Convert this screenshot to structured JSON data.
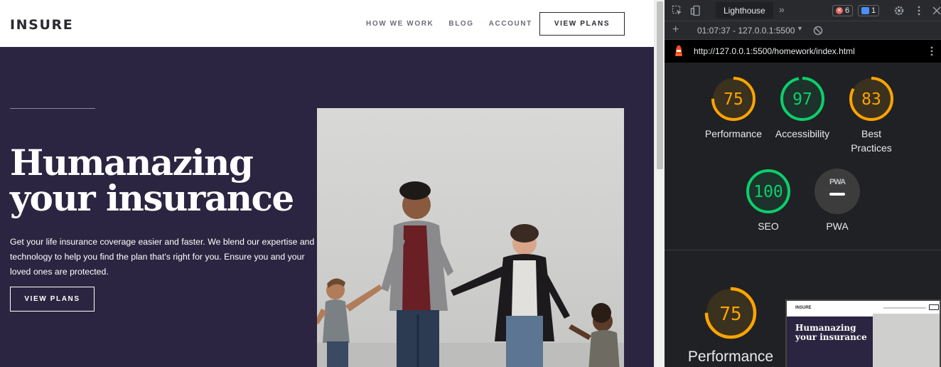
{
  "site": {
    "logo": "INSURE",
    "nav": [
      "HOW WE WORK",
      "BLOG",
      "ACCOUNT"
    ],
    "nav_button": "VIEW PLANS",
    "hero_title_line1": "Humanazing",
    "hero_title_line2": "your insurance",
    "hero_text": "Get your life insurance coverage easier and faster. We blend our expertise and technology to help you find the plan that's right for you. Ensure you and your loved ones are protected.",
    "hero_button": "VIEW PLANS"
  },
  "devtools": {
    "active_tab": "Lighthouse",
    "more_tabs": "»",
    "error_count": "6",
    "message_count": "1",
    "report_selector": "01:07:37 - 127.0.0.1:5500",
    "audited_url": "http://127.0.0.1:5500/homework/index.html",
    "pwa_badge": "PWA",
    "scores": [
      {
        "label": "Performance",
        "score": "75",
        "value": 75,
        "color": "#ffa400"
      },
      {
        "label": "Accessibility",
        "score": "97",
        "value": 97,
        "color": "#0cce6b"
      },
      {
        "label": "Best Practices",
        "score": "83",
        "value": 83,
        "color": "#ffa400"
      },
      {
        "label": "SEO",
        "score": "100",
        "value": 100,
        "color": "#0cce6b"
      },
      {
        "label": "PWA",
        "score": "",
        "value": 0,
        "color": "#5f6368"
      }
    ],
    "performance_detail": {
      "label": "Performance",
      "score": "75",
      "value": 75,
      "color": "#ffa400"
    },
    "thumbnail": {
      "logo": "INSURE",
      "title_line1": "Humanazing",
      "title_line2": "your insurance"
    }
  }
}
